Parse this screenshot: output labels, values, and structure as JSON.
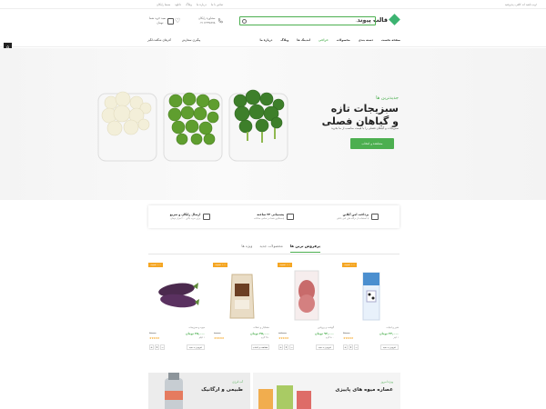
{
  "topbar": {
    "welcome": "وب ناهید اند کافی، پذیرفتید!",
    "links": [
      "تماس با ما",
      "درباره ما",
      "وبلاگ",
      "دانلود",
      "ضبط رایگان"
    ]
  },
  "header": {
    "logo_text": "قالب پیوند",
    "search_placeholder": "جستجو کنید...",
    "support_line1": "مشاوره رایگان",
    "support_line2": "۰۲۱۱۲۳۴۵۶۷۸",
    "cart_line1": "سبد خرید شما",
    "cart_line2": "۰ تومان"
  },
  "nav": {
    "items": [
      "صفحه نخست",
      "دسته بندی",
      "محصولات",
      "حراجی",
      "لندینگ ها",
      "وبلاگ",
      "درباره ما"
    ],
    "active_index": 3,
    "extra": [
      "پیگیری سفارش",
      "آفرهای شگفت‌انگیز"
    ]
  },
  "sidebar": {
    "icons": [
      "home-icon",
      "settings-icon",
      "star-icon",
      "cart-icon"
    ]
  },
  "hero": {
    "tag": "جدیدترین ها",
    "title_line1": "سبزیجات تازه",
    "title_line2": "و گیاهان فصلی",
    "subtitle": "سبزیجات و گیاهان فصلی را با قیمت مناسب از ما بخرید",
    "cta": "مشاهده و انتخاب"
  },
  "features": [
    {
      "title": "پرداخت امن آنلاین",
      "sub": "با استفاده از درگاه های امن بانکی"
    },
    {
      "title": "پشتیبانی ۲۴ ساعته",
      "sub": "پاسخگوی شما در تمامی ساعات"
    },
    {
      "title": "ارسال رایگان و سریع",
      "sub": "برای خرید بالای ۲۰۰ هزار تومان"
    }
  ],
  "tabs": {
    "items": [
      "پرفروش ترین ها",
      "محصولات جدید",
      "ویژه ها"
    ],
    "active_index": 0
  },
  "products": [
    {
      "badge": "۱۰٪ تخفیف",
      "category": "شیر و لبنیات",
      "price": "۳۴,۰۰۰ تومان",
      "old": "۳۸,۰۰۰",
      "unit": "۱ لیتر",
      "add": "افزودن به سبد"
    },
    {
      "badge": "۱۰٪ تخفیف",
      "category": "گوشت و پروتئین",
      "price": "۹۲,۰۰۰ تومان",
      "old": "۱۰۲,۰۰۰",
      "unit": "۵۰۰ گرم",
      "add": "افزودن به سبد"
    },
    {
      "badge": "۱۰٪ تخفیف",
      "category": "خشکبار و تنقلات",
      "price": "۴۵,۰۰۰ تومان",
      "old": "۵۰,۰۰۰",
      "unit": "۲۵۰ گرم",
      "add": "مشاهده و انتخاب"
    },
    {
      "badge": "۱۰٪ تخفیف",
      "category": "میوه و سبزیجات",
      "price": "۲۵,۰۰۰ تومان",
      "old": "۲۸,۰۰۰",
      "unit": "۱ کیلو",
      "add": "افزودن به سبد"
    }
  ],
  "banners": [
    {
      "tag": "ویژه امروز",
      "title": "عصاره میوه های پاییزی"
    },
    {
      "tag": "آب انرژی",
      "title": "طبیعی و ارگانیک"
    }
  ],
  "colors": {
    "accent": "#4caf50",
    "badge": "#f5a623"
  }
}
